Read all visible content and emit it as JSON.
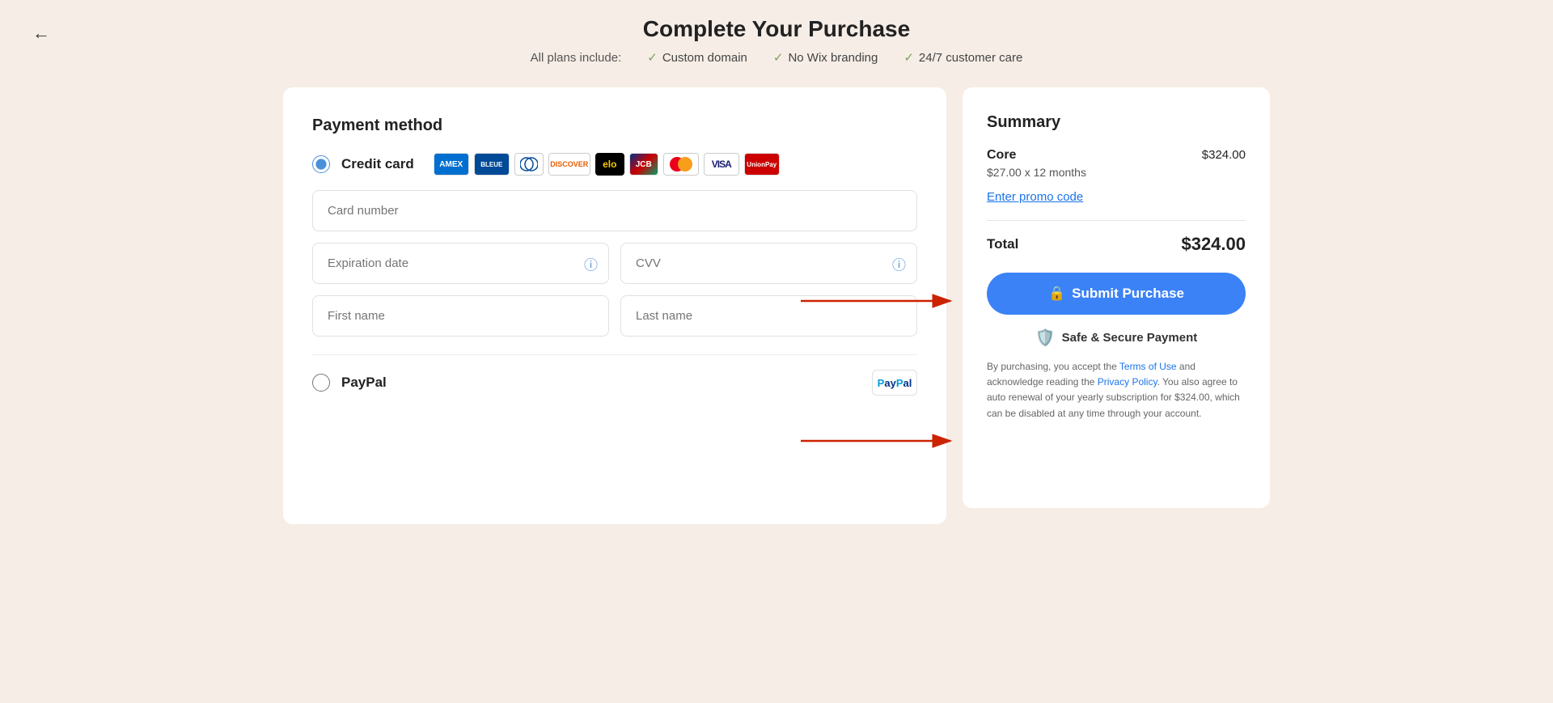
{
  "page": {
    "title": "Complete Your Purchase",
    "back_arrow": "←"
  },
  "plans_bar": {
    "label": "All plans include:",
    "items": [
      {
        "text": "Custom domain"
      },
      {
        "text": "No Wix branding"
      },
      {
        "text": "24/7 customer care"
      }
    ]
  },
  "payment": {
    "section_title": "Payment method",
    "credit_card": {
      "label": "Credit card",
      "selected": true,
      "logos": [
        "AMEX",
        "BLEUE",
        "Diners",
        "DISCOVER",
        "elo",
        "JCB",
        "MC",
        "VISA",
        "UnionPay"
      ]
    },
    "fields": {
      "card_number_placeholder": "Card number",
      "expiration_placeholder": "Expiration date",
      "cvv_placeholder": "CVV",
      "first_name_placeholder": "First name",
      "last_name_placeholder": "Last name"
    },
    "paypal": {
      "label": "PayPal",
      "selected": false
    }
  },
  "summary": {
    "title": "Summary",
    "product": {
      "name": "Core",
      "detail": "$27.00 x 12 months",
      "price": "$324.00"
    },
    "promo_link": "Enter promo code",
    "total_label": "Total",
    "total_amount": "$324.00",
    "submit_btn": "Submit Purchase",
    "secure_label": "Safe & Secure Payment",
    "legal_text_1": "By purchasing, you accept the ",
    "terms_link": "Terms of Use",
    "legal_text_2": " and acknowledge reading the ",
    "privacy_link": "Privacy Policy",
    "legal_text_3": ". You also agree to auto renewal of your yearly subscription for $324.00, which can be disabled at any time through your account."
  }
}
